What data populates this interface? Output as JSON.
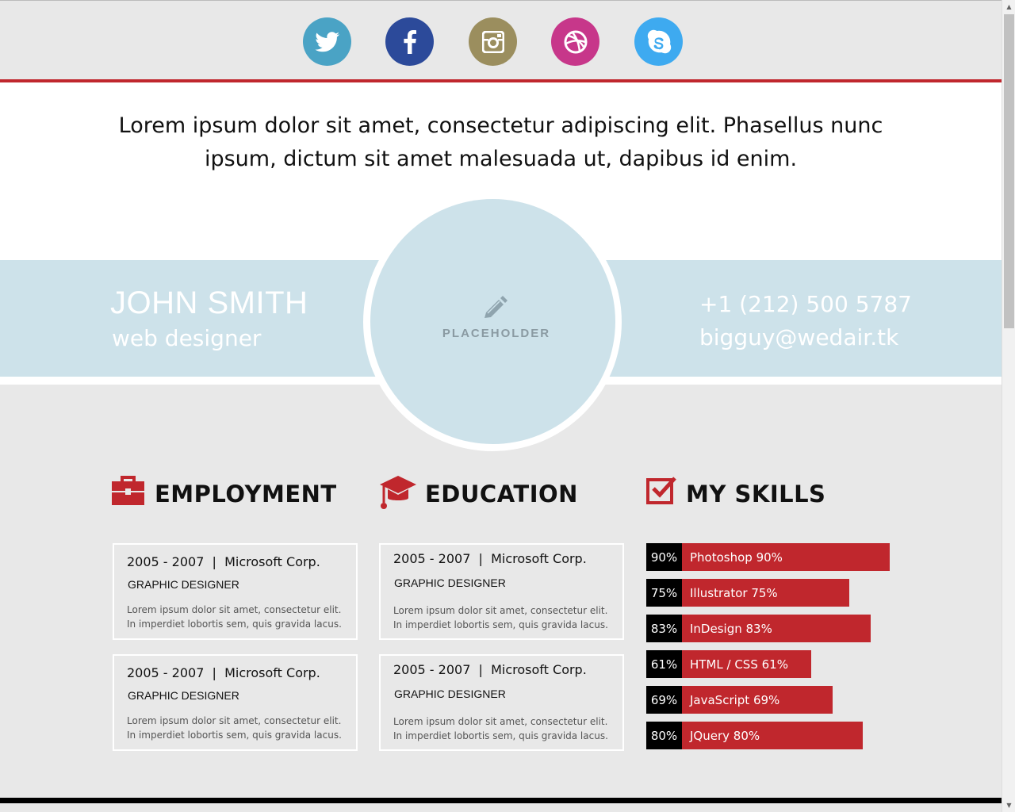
{
  "social": [
    {
      "name": "twitter-icon",
      "color": "#4aa3c5"
    },
    {
      "name": "facebook-icon",
      "color": "#2c4a9a"
    },
    {
      "name": "instagram-icon",
      "color": "#9b8e5e"
    },
    {
      "name": "dribbble-icon",
      "color": "#c7378a"
    },
    {
      "name": "skype-icon",
      "color": "#3eaaf0"
    }
  ],
  "intro": "Lorem ipsum dolor sit amet, consectetur adipiscing elit. Phasellus nunc ipsum, dictum sit amet malesuada ut, dapibus id enim.",
  "profile": {
    "name": "JOHN SMITH",
    "role": "web designer",
    "phone": "+1 (212) 500 5787",
    "email": "bigguy@wedair.tk",
    "avatar_label": "PLACEHOLDER"
  },
  "sections": {
    "employment": "EMPLOYMENT",
    "education": "EDUCATION",
    "skills": "MY SKILLS"
  },
  "employment": [
    {
      "period": "2005 - 2007  |  Microsoft Corp.",
      "title": "GRAPHIC DESIGNER",
      "desc": "Lorem ipsum dolor sit amet, consectetur elit. In imperdiet lobortis sem, quis gravida lacus."
    },
    {
      "period": "2005 - 2007  |  Microsoft Corp.",
      "title": "GRAPHIC DESIGNER",
      "desc": "Lorem ipsum dolor sit amet, consectetur elit. In imperdiet lobortis sem, quis gravida lacus."
    }
  ],
  "education": [
    {
      "period": "2005 - 2007  |  Microsoft Corp.",
      "title": "GRAPHIC DESIGNER",
      "desc": "Lorem ipsum dolor sit amet, consectetur elit. In imperdiet lobortis sem, quis gravida lacus."
    },
    {
      "period": "2005 - 2007  |  Microsoft Corp.",
      "title": "GRAPHIC DESIGNER",
      "desc": "Lorem ipsum dolor sit amet, consectetur elit. In imperdiet lobortis sem, quis gravida lacus."
    }
  ],
  "skills": [
    {
      "pct_label": "90%",
      "label": "Photoshop  90%",
      "value": 90
    },
    {
      "pct_label": "75%",
      "label": "Illustrator  75%",
      "value": 75
    },
    {
      "pct_label": "83%",
      "label": "InDesign  83%",
      "value": 83
    },
    {
      "pct_label": "61%",
      "label": "HTML / CSS  61%",
      "value": 61
    },
    {
      "pct_label": "69%",
      "label": "JavaScript  69%",
      "value": 69
    },
    {
      "pct_label": "80%",
      "label": "JQuery  80%",
      "value": 80
    }
  ],
  "colors": {
    "accent": "#c0272d",
    "band": "#cde2ea",
    "page_bg": "#e8e8e8"
  }
}
